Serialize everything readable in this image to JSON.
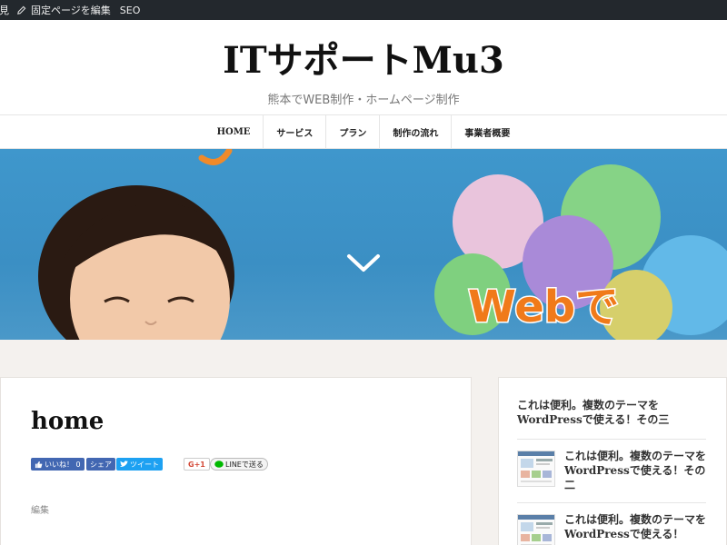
{
  "adminbar": {
    "view_label": "表示を見",
    "edit_label": "固定ページを編集",
    "seo_label": "SEO"
  },
  "header": {
    "site_title": "ITサポートMu3",
    "tagline": "熊本でWEB制作・ホームページ制作"
  },
  "nav": {
    "items": [
      {
        "label": "HOME"
      },
      {
        "label": "サービス"
      },
      {
        "label": "プラン"
      },
      {
        "label": "制作の流れ"
      },
      {
        "label": "事業者概要"
      }
    ]
  },
  "hero": {
    "balloon_text": "Webで",
    "colors": {
      "sky": "#3f97cc",
      "balloon_pink": "#e9b8d6",
      "balloon_green": "#7fd07f",
      "balloon_purple": "#a98ad8",
      "balloon_blue": "#5fb8e8"
    }
  },
  "main": {
    "page_title": "home",
    "share": {
      "like_label": "いいね！ 0",
      "share_label": "シェア",
      "tweet_label": "ツイート",
      "gplus_label": "G+1",
      "line_label": "LINEで送る"
    },
    "edit_label": "編集"
  },
  "sidebar": {
    "first_post": "これは便利。複数のテーマをWordPressで使える！その三",
    "posts": [
      {
        "title": "これは便利。複数のテーマをWordPressで使える！その二"
      },
      {
        "title": "これは便利。複数のテーマをWordPressで使える！"
      }
    ]
  }
}
